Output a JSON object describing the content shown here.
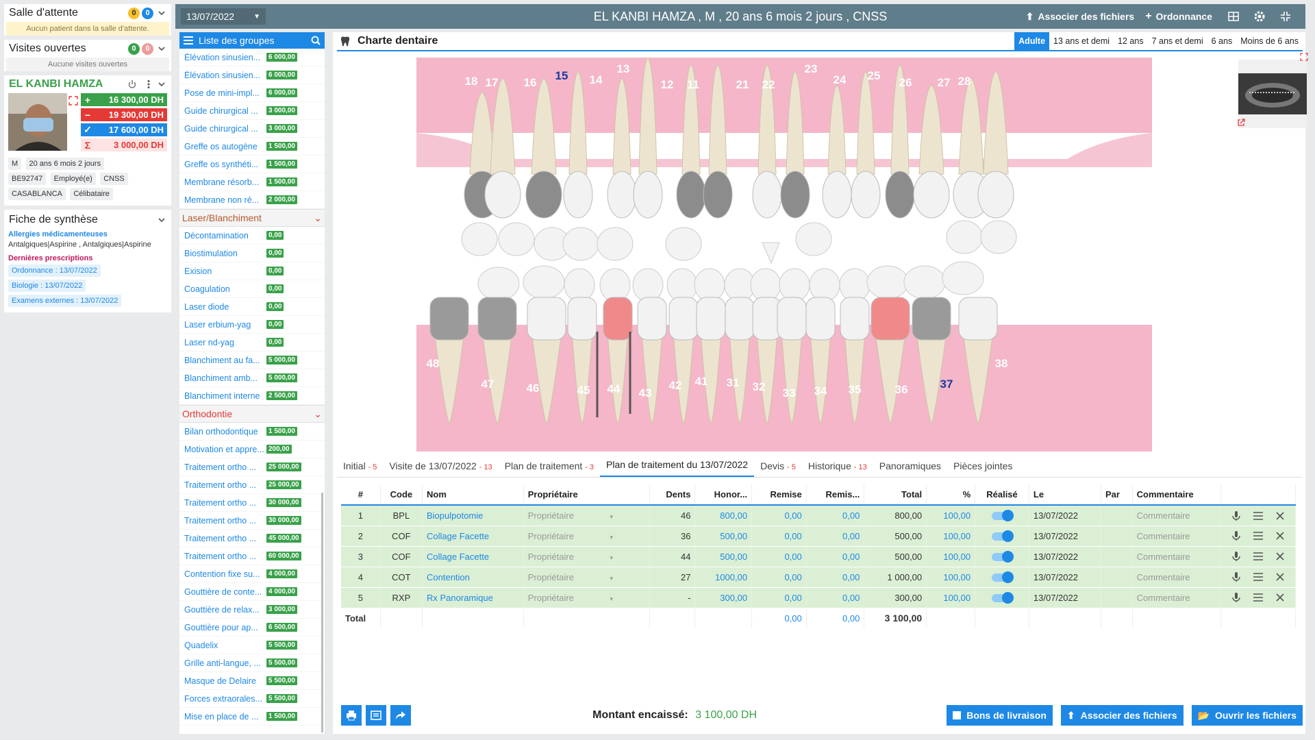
{
  "waiting": {
    "title": "Salle d'attente",
    "count1": "0",
    "count2": "0",
    "notice": "Aucun patient dans la salle d'attente."
  },
  "visits": {
    "title": "Visites ouvertes",
    "count1": "0",
    "count2": "0",
    "notice": "Aucune visites ouvertes"
  },
  "patient": {
    "name": "EL KANBI HAMZA",
    "balances": [
      "16 300,00 DH",
      "19 300,00 DH",
      "17 600,00 DH",
      "3 000,00 DH"
    ],
    "tags": [
      "M",
      "20 ans 6 mois 2 jours",
      "BE92747",
      "Employé(e)",
      "CNSS",
      "CASABLANCA",
      "Célibataire"
    ]
  },
  "synthese": {
    "title": "Fiche de synthèse",
    "allergy_label": "Allergies médicamenteuses",
    "allergy_text": "Antalgiques|Aspirine , Antalgiques|Aspirine",
    "prescr_label": "Dernières prescriptions",
    "links": [
      "Ordonnance : 13/07/2022",
      "Biologie : 13/07/2022",
      "Examens externes : 13/07/2022"
    ]
  },
  "groups": {
    "title": "Liste des groupes",
    "items": [
      {
        "name": "Élévation sinusien...",
        "price": "6 000,00"
      },
      {
        "name": "Élévation sinusien...",
        "price": "6 000,00"
      },
      {
        "name": "Pose de mini-impl...",
        "price": "6 000,00"
      },
      {
        "name": "Guide chirurgical ...",
        "price": "3 000,00"
      },
      {
        "name": "Guide chirurgical ...",
        "price": "3 000,00"
      },
      {
        "name": "Greffe os autogène",
        "price": "1 500,00"
      },
      {
        "name": "Greffe os synthéti...",
        "price": "1 500,00"
      },
      {
        "name": "Membrane résorb...",
        "price": "1 500,00"
      },
      {
        "name": "Membrane non ré...",
        "price": "2 000,00"
      },
      {
        "cat": "Laser/Blanchiment"
      },
      {
        "name": "Décontamination",
        "price": "0,00"
      },
      {
        "name": "Biostimulation",
        "price": "0,00"
      },
      {
        "name": "Exision",
        "price": "0,00"
      },
      {
        "name": "Coagulation",
        "price": "0,00"
      },
      {
        "name": "Laser diode",
        "price": "0,00"
      },
      {
        "name": "Laser erbium-yag",
        "price": "0,00"
      },
      {
        "name": "Laser nd-yag",
        "price": "0,00"
      },
      {
        "name": "Blanchiment au fa...",
        "price": "5 000,00"
      },
      {
        "name": "Blanchiment amb...",
        "price": "5 000,00"
      },
      {
        "name": "Blanchiment interne",
        "price": "2 500,00"
      },
      {
        "cat": "Orthodontie"
      },
      {
        "name": "Bilan orthodontique",
        "price": "1 500,00"
      },
      {
        "name": "Motivation et appre...",
        "price": "200,00"
      },
      {
        "name": "Traitement ortho ...",
        "price": "25 000,00"
      },
      {
        "name": "Traitement ortho ...",
        "price": "25 000,00"
      },
      {
        "name": "Traitement ortho ...",
        "price": "30 000,00"
      },
      {
        "name": "Traitement ortho ...",
        "price": "30 000,00"
      },
      {
        "name": "Traitement ortho ...",
        "price": "45 000,00"
      },
      {
        "name": "Traitement ortho ...",
        "price": "60 000,00"
      },
      {
        "name": "Contention fixe su...",
        "price": "4 000,00"
      },
      {
        "name": "Gouttière de conte...",
        "price": "4 000,00"
      },
      {
        "name": "Gouttière de relax...",
        "price": "3 000,00"
      },
      {
        "name": "Gouttière pour ap...",
        "price": "6 500,00"
      },
      {
        "name": "Quadelix",
        "price": "5 500,00"
      },
      {
        "name": "Grille anti-langue, ...",
        "price": "5 500,00"
      },
      {
        "name": "Masque de Delaire",
        "price": "5 500,00"
      },
      {
        "name": "Forces extraorales...",
        "price": "5 500,00"
      },
      {
        "name": "Mise en place de ...",
        "price": "1 500,00"
      }
    ]
  },
  "topbar": {
    "date": "13/07/2022",
    "title": "EL KANBI HAMZA , M , 20 ans 6 mois 2 jours , CNSS",
    "assoc": "Associer des fichiers",
    "ordo": "Ordonnance"
  },
  "chart": {
    "title": "Charte dentaire",
    "ages": [
      "Adulte",
      "13 ans et demi",
      "12 ans",
      "7 ans et demi",
      "6 ans",
      "Moins de 6 ans"
    ],
    "upper_numbers": [
      "18",
      "17",
      "16",
      "15",
      "14",
      "13",
      "12",
      "11",
      "21",
      "22",
      "23",
      "24",
      "25",
      "26",
      "27",
      "28"
    ],
    "lower_numbers": [
      "48",
      "47",
      "46",
      "45",
      "44",
      "43",
      "42",
      "41",
      "31",
      "32",
      "33",
      "34",
      "35",
      "36",
      "37",
      "38"
    ]
  },
  "tabs": [
    {
      "label": "Initial",
      "count": "- 5"
    },
    {
      "label": "Visite de 13/07/2022",
      "count": "- 13"
    },
    {
      "label": "Plan de traitement",
      "count": "- 3"
    },
    {
      "label": "Plan de traitement du 13/07/2022",
      "count": ""
    },
    {
      "label": "Devis",
      "count": "- 5"
    },
    {
      "label": "Historique",
      "count": "- 13"
    },
    {
      "label": "Panoramiques",
      "count": ""
    },
    {
      "label": "Pièces jointes",
      "count": ""
    }
  ],
  "table": {
    "headers": [
      "#",
      "Code",
      "Nom",
      "Propriétaire",
      "Dents",
      "Honor...",
      "Remise",
      "Remis...",
      "Total",
      "%",
      "Réalisé",
      "Le",
      "Par",
      "Commentaire"
    ],
    "rows": [
      {
        "n": "1",
        "code": "BPL",
        "nom": "Biopulpotomie",
        "prop": "Propriétaire",
        "dents": "46",
        "hon": "800,00",
        "rem": "0,00",
        "rem2": "0,00",
        "total": "800,00",
        "pct": "100,00",
        "date": "13/07/2022",
        "comment": "Commentaire"
      },
      {
        "n": "2",
        "code": "COF",
        "nom": "Collage Facette",
        "prop": "Propriétaire",
        "dents": "36",
        "hon": "500,00",
        "rem": "0,00",
        "rem2": "0,00",
        "total": "500,00",
        "pct": "100,00",
        "date": "13/07/2022",
        "comment": "Commentaire"
      },
      {
        "n": "3",
        "code": "COF",
        "nom": "Collage Facette",
        "prop": "Propriétaire",
        "dents": "44",
        "hon": "500,00",
        "rem": "0,00",
        "rem2": "0,00",
        "total": "500,00",
        "pct": "100,00",
        "date": "13/07/2022",
        "comment": "Commentaire"
      },
      {
        "n": "4",
        "code": "COT",
        "nom": "Contention",
        "prop": "Propriétaire",
        "dents": "27",
        "hon": "1000,00",
        "rem": "0,00",
        "rem2": "0,00",
        "total": "1 000,00",
        "pct": "100,00",
        "date": "13/07/2022",
        "comment": "Commentaire"
      },
      {
        "n": "5",
        "code": "RXP",
        "nom": "Rx Panoramique",
        "prop": "Propriétaire",
        "dents": "-",
        "hon": "300,00",
        "rem": "0,00",
        "rem2": "0,00",
        "total": "300,00",
        "pct": "100,00",
        "date": "13/07/2022",
        "comment": "Commentaire"
      }
    ],
    "total": {
      "label": "Total",
      "rem": "0,00",
      "rem2": "0,00",
      "total": "3 100,00"
    }
  },
  "footer": {
    "encaisse_label": "Montant encaissé:",
    "encaisse_value": "3 100,00 DH",
    "btn_bons": "Bons de livraison",
    "btn_assoc": "Associer des fichiers",
    "btn_open": "Ouvrir les fichiers"
  },
  "colors": {
    "primary": "#1e88e5",
    "header": "#607d8b",
    "green": "#3aa14a",
    "red": "#e53935",
    "gum": "#f4b6c8"
  }
}
